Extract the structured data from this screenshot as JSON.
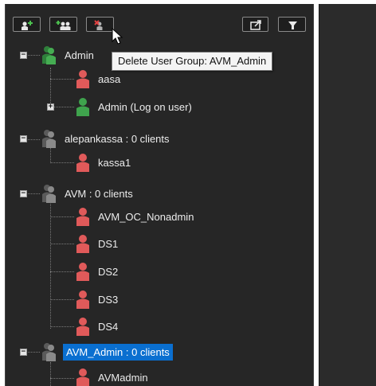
{
  "toolbar": {
    "buttons": [
      {
        "name": "add-user-button",
        "icon": "add-user-icon"
      },
      {
        "name": "add-user-group-button",
        "icon": "add-group-icon"
      },
      {
        "name": "delete-user-group-button",
        "icon": "delete-group-icon"
      },
      {
        "name": "export-button",
        "icon": "export-icon"
      },
      {
        "name": "filter-button",
        "icon": "filter-icon"
      }
    ]
  },
  "tooltip": {
    "text": "Delete User Group: AVM_Admin"
  },
  "tree": {
    "groups": [
      {
        "label": "Admin",
        "children": [
          {
            "label": "aasa",
            "type": "user"
          },
          {
            "label": "Admin (Log on user)",
            "type": "user-self",
            "collapsed": true
          }
        ]
      },
      {
        "label": "alepankassa : 0 clients",
        "children": [
          {
            "label": "kassa1",
            "type": "user"
          }
        ]
      },
      {
        "label": "AVM : 0 clients",
        "children": [
          {
            "label": "AVM_OC_Nonadmin",
            "type": "user"
          },
          {
            "label": "DS1",
            "type": "user"
          },
          {
            "label": "DS2",
            "type": "user"
          },
          {
            "label": "DS3",
            "type": "user"
          },
          {
            "label": "DS4",
            "type": "user"
          }
        ]
      },
      {
        "label": "AVM_Admin : 0 clients",
        "selected": true,
        "children": [
          {
            "label": "AVMadmin",
            "type": "user"
          }
        ]
      }
    ]
  },
  "colors": {
    "panel_bg": "#262626",
    "user_red": "#e05a5a",
    "user_green": "#3fa34d",
    "group_gray": "#7d7d7d",
    "selection_blue": "#0a6fd0"
  }
}
